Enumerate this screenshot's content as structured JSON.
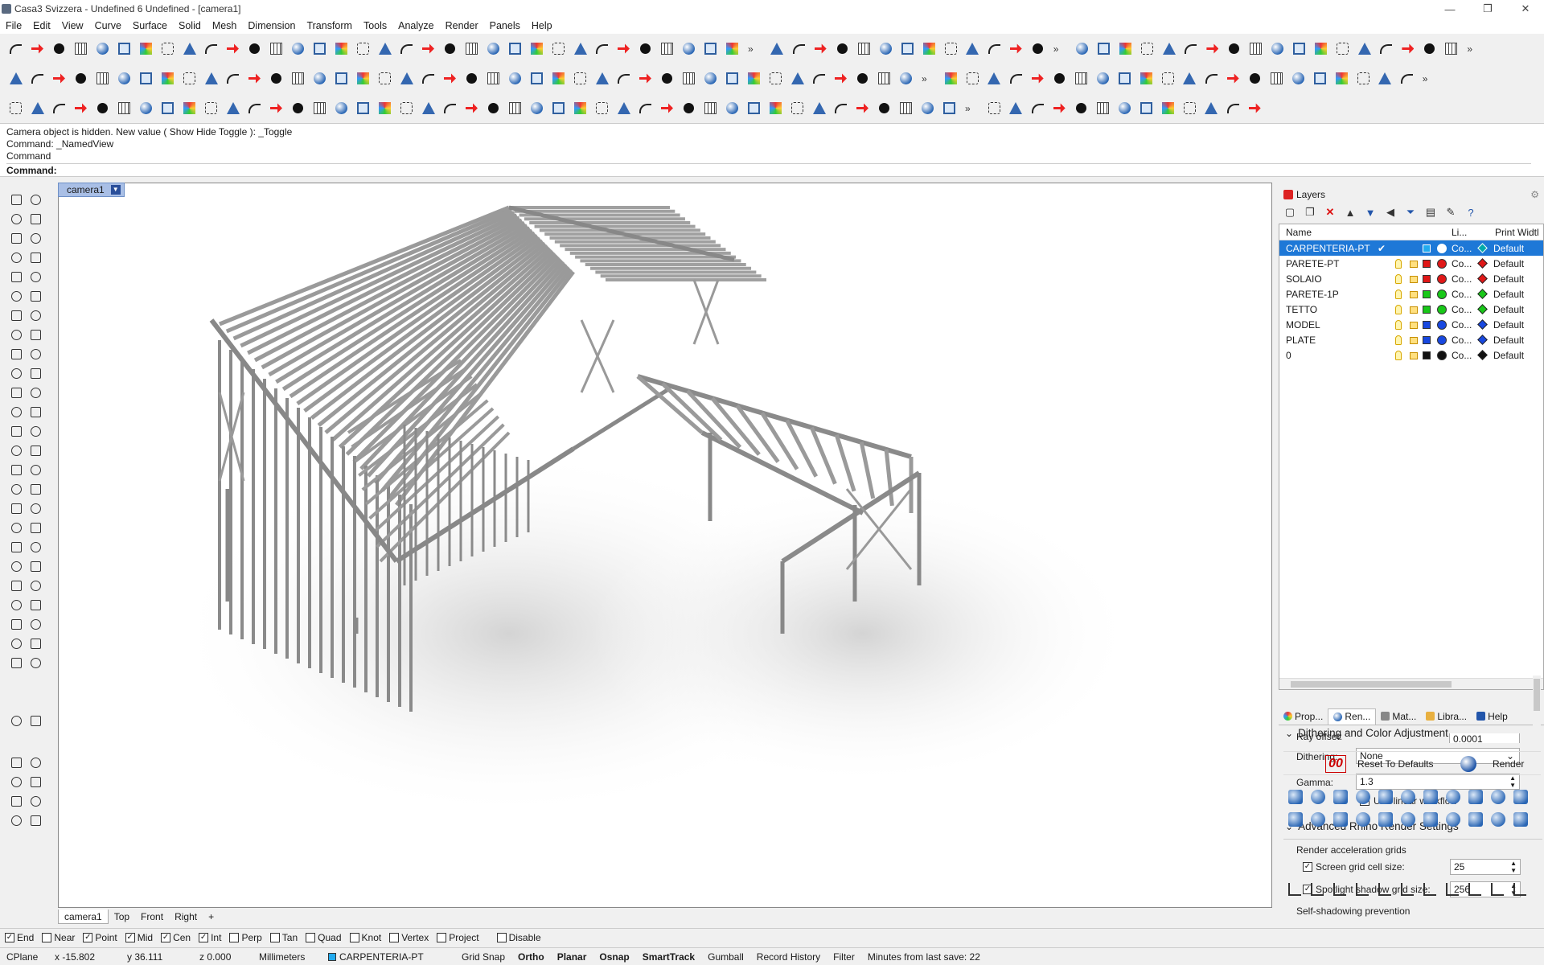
{
  "title": "Casa3 Svizzera - Undefined 6 Undefined - [camera1]",
  "menu": [
    "File",
    "Edit",
    "View",
    "Curve",
    "Surface",
    "Solid",
    "Mesh",
    "Dimension",
    "Transform",
    "Tools",
    "Analyze",
    "Render",
    "Panels",
    "Help"
  ],
  "command_history": [
    "Camera object is hidden. New value ( Show  Hide  Toggle ): _Toggle",
    "Command: _NamedView",
    "Command"
  ],
  "command_prompt": "Command:",
  "viewport": {
    "name": "camera1",
    "tabs": [
      "camera1",
      "Top",
      "Front",
      "Right"
    ],
    "add_tab": "+"
  },
  "layers": {
    "title": "Layers",
    "headers": {
      "name": "Name",
      "linetype": "Li...",
      "print_width": "Print Widtl"
    },
    "rows": [
      {
        "name": "CARPENTERIA-PT",
        "color": "#22aaee",
        "material": "Co...",
        "print_color": "#0aa",
        "print_width": "Default",
        "selected": true
      },
      {
        "name": "PARETE-PT",
        "color": "#e01818",
        "material": "Co...",
        "print_color": "#e01818",
        "print_width": "Default"
      },
      {
        "name": "SOLAIO",
        "color": "#e01818",
        "material": "Co...",
        "print_color": "#e01818",
        "print_width": "Default"
      },
      {
        "name": "PARETE-1P",
        "color": "#18c818",
        "material": "Co...",
        "print_color": "#18c818",
        "print_width": "Default"
      },
      {
        "name": "TETTO",
        "color": "#18c818",
        "material": "Co...",
        "print_color": "#18c818",
        "print_width": "Default"
      },
      {
        "name": "MODEL",
        "color": "#1848e0",
        "material": "Co...",
        "print_color": "#1848e0",
        "print_width": "Default"
      },
      {
        "name": "PLATE",
        "color": "#1848e0",
        "material": "Co...",
        "print_color": "#1848e0",
        "print_width": "Default"
      },
      {
        "name": "0",
        "color": "#111111",
        "material": "Co...",
        "print_color": "#111111",
        "print_width": "Default"
      }
    ]
  },
  "panel_tabs": [
    "Prop...",
    "Ren...",
    "Mat...",
    "Libra...",
    "Help"
  ],
  "render": {
    "section1": "Dithering and Color Adjustment",
    "dithering_label": "Dithering:",
    "dithering_value": "None",
    "gamma_label": "Gamma:",
    "gamma_value": "1.3",
    "linear_label": "Use linear workflow",
    "section2": "Advanced Rhino Render Settings",
    "accel_label": "Render acceleration grids",
    "screen_grid_label": "Screen grid cell size:",
    "screen_grid_value": "25",
    "spot_label": "Spotlight shadow grid size:",
    "spot_value": "256",
    "self_shadow_label": "Self-shadowing prevention",
    "ray_offset_label": "Ray offset:",
    "ray_offset_value": "0.0001",
    "reset_button": "Reset To Defaults",
    "render_button": "Render"
  },
  "osnap": {
    "items": [
      {
        "label": "End",
        "checked": true
      },
      {
        "label": "Near",
        "checked": false
      },
      {
        "label": "Point",
        "checked": true
      },
      {
        "label": "Mid",
        "checked": true
      },
      {
        "label": "Cen",
        "checked": true
      },
      {
        "label": "Int",
        "checked": true
      },
      {
        "label": "Perp",
        "checked": false
      },
      {
        "label": "Tan",
        "checked": false
      },
      {
        "label": "Quad",
        "checked": false
      },
      {
        "label": "Knot",
        "checked": false
      },
      {
        "label": "Vertex",
        "checked": false
      },
      {
        "label": "Project",
        "checked": false
      },
      {
        "label": "Disable",
        "checked": false
      }
    ]
  },
  "status": {
    "cplane": "CPlane",
    "x": "x -15.802",
    "y": "y 36.111",
    "z": "z 0.000",
    "units": "Millimeters",
    "layer": "CARPENTERIA-PT",
    "grid_snap": "Grid Snap",
    "ortho": "Ortho",
    "planar": "Planar",
    "osnap": "Osnap",
    "smarttrack": "SmartTrack",
    "gumball": "Gumball",
    "record_history": "Record History",
    "filter": "Filter",
    "last_save": "Minutes from last save: 22"
  }
}
